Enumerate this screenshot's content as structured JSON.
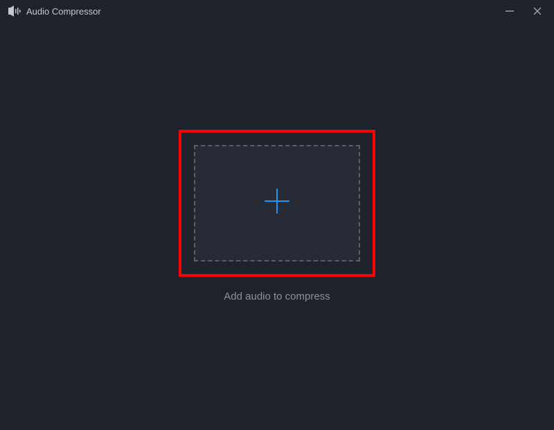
{
  "titlebar": {
    "title": "Audio Compressor"
  },
  "main": {
    "instruction": "Add audio to compress"
  },
  "colors": {
    "accent": "#2196f3",
    "highlight_border": "#ff0000"
  }
}
